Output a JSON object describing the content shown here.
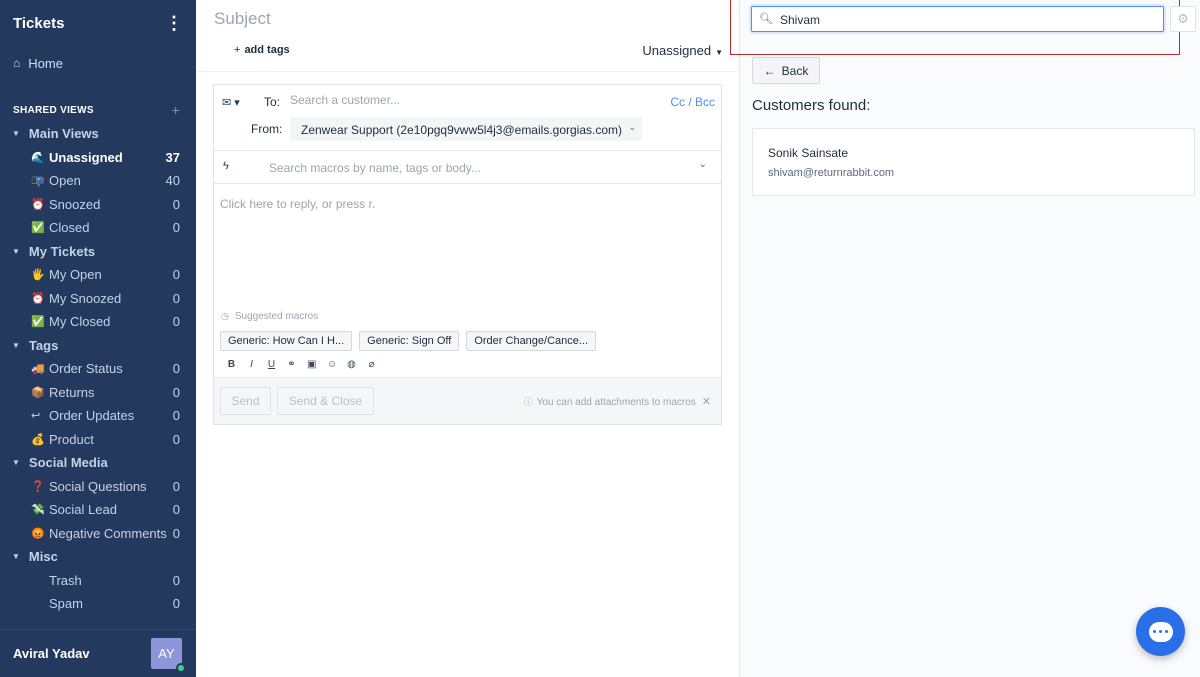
{
  "sidebar": {
    "title": "Tickets",
    "home": "Home",
    "shared_views": "SHARED VIEWS",
    "groups": [
      {
        "label": "Main Views",
        "items": [
          {
            "emoji": "🌊",
            "label": "Unassigned",
            "count": "37",
            "active": true
          },
          {
            "emoji": "📭",
            "label": "Open",
            "count": "40"
          },
          {
            "emoji": "⏰",
            "label": "Snoozed",
            "count": "0"
          },
          {
            "emoji": "✅",
            "label": "Closed",
            "count": "0"
          }
        ]
      },
      {
        "label": "My Tickets",
        "items": [
          {
            "emoji": "🖐",
            "label": "My Open",
            "count": "0"
          },
          {
            "emoji": "⏰",
            "label": "My Snoozed",
            "count": "0"
          },
          {
            "emoji": "✅",
            "label": "My Closed",
            "count": "0"
          }
        ]
      },
      {
        "label": "Tags",
        "items": [
          {
            "emoji": "🚚",
            "label": "Order Status",
            "count": "0"
          },
          {
            "emoji": "📦",
            "label": "Returns",
            "count": "0"
          },
          {
            "emoji": "↩",
            "label": "Order Updates",
            "count": "0"
          },
          {
            "emoji": "💰",
            "label": "Product",
            "count": "0"
          }
        ]
      },
      {
        "label": "Social Media",
        "items": [
          {
            "emoji": "❓",
            "label": "Social Questions",
            "count": "0"
          },
          {
            "emoji": "💸",
            "label": "Social Lead",
            "count": "0"
          },
          {
            "emoji": "😡",
            "label": "Negative Comments",
            "count": "0"
          }
        ]
      },
      {
        "label": "Misc",
        "items": [
          {
            "emoji": "",
            "label": "Trash",
            "count": "0"
          },
          {
            "emoji": "",
            "label": "Spam",
            "count": "0"
          }
        ]
      }
    ],
    "user": {
      "name": "Aviral Yadav",
      "initials": "AY"
    }
  },
  "ticket": {
    "subject_placeholder": "Subject",
    "add_tags": "add tags",
    "assignee": "Unassigned",
    "to_label": "To:",
    "to_placeholder": "Search a customer...",
    "cc_bcc": "Cc / Bcc",
    "from_label": "From:",
    "from_value": "Zenwear Support (2e10pgq9vww5l4j3@emails.gorgias.com)",
    "macro_placeholder": "Search macros by name, tags or body...",
    "reply_placeholder": "Click here to reply, or press r.",
    "suggested_macros": "Suggested macros",
    "macros": [
      "Generic: How Can I H...",
      "Generic: Sign Off",
      "Order Change/Cance..."
    ],
    "send": "Send",
    "send_close": "Send & Close",
    "attach_hint": "You can add attachments to macros"
  },
  "customer_panel": {
    "search_value": "Shivam",
    "back": "Back",
    "found_title": "Customers found:",
    "results": [
      {
        "name": "Sonik Sainsate",
        "email": "shivam@returnrabbit.com"
      }
    ]
  },
  "colors": {
    "sidebar_bg": "#233a5e",
    "accent": "#2a6ee8",
    "highlight_border": "#b72a2a"
  }
}
